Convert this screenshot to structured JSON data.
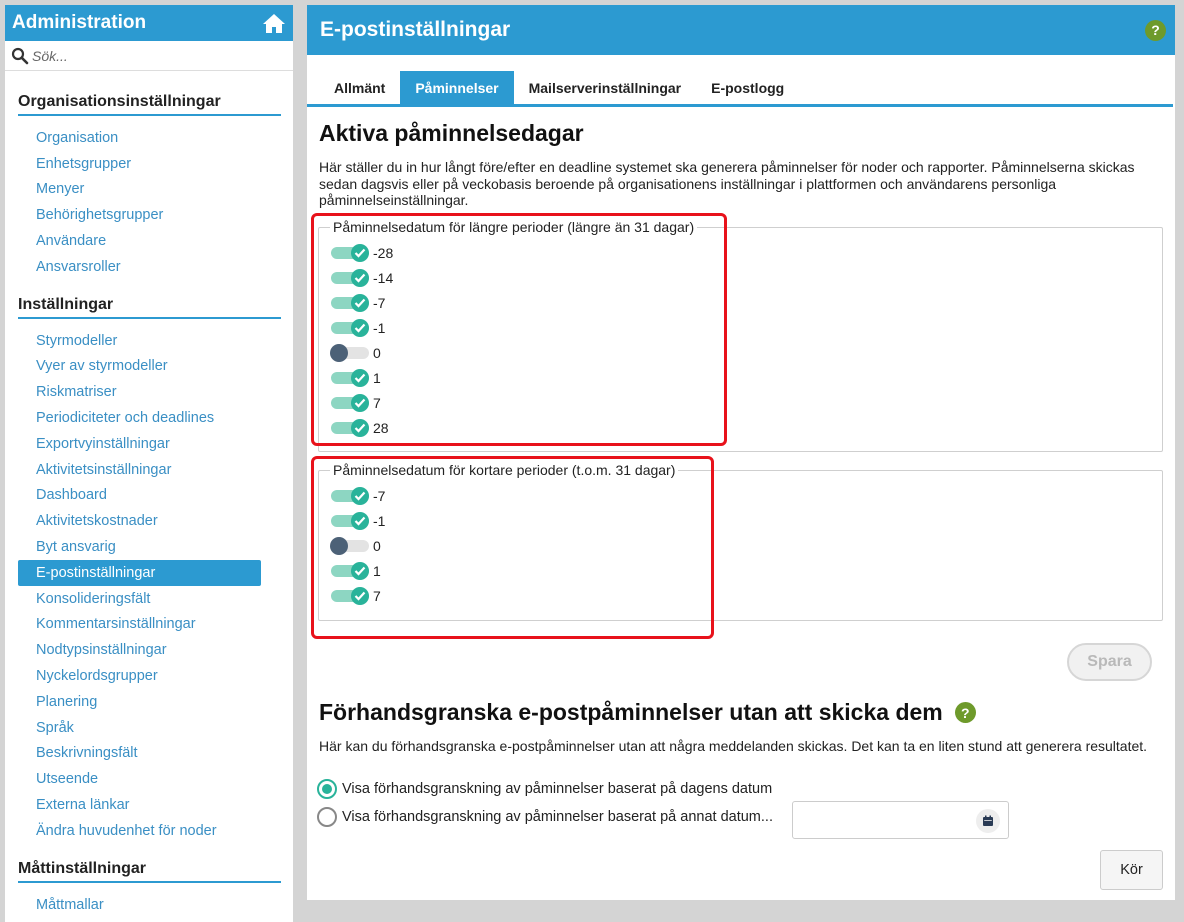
{
  "sidebar": {
    "title": "Administration",
    "search_placeholder": "Sök...",
    "sections": [
      {
        "title": "Organisationsinställningar",
        "items": [
          "Organisation",
          "Enhetsgrupper",
          "Menyer",
          "Behörighetsgrupper",
          "Användare",
          "Ansvarsroller"
        ]
      },
      {
        "title": "Inställningar",
        "items": [
          "Styrmodeller",
          "Vyer av styrmodeller",
          "Riskmatriser",
          "Periodiciteter och deadlines",
          "Exportvyinställningar",
          "Aktivitetsinställningar",
          "Dashboard",
          "Aktivitetskostnader",
          "Byt ansvarig",
          "E-postinställningar",
          "Konsolideringsfält",
          "Kommentarsinställningar",
          "Nodtypsinställningar",
          "Nyckelordsgrupper",
          "Planering",
          "Språk",
          "Beskrivningsfält",
          "Utseende",
          "Externa länkar",
          "Ändra huvudenhet för noder"
        ]
      },
      {
        "title": "Måttinställningar",
        "items": [
          "Måttmallar"
        ]
      }
    ],
    "active_item": "E-postinställningar"
  },
  "main": {
    "title": "E-postinställningar",
    "tabs": [
      {
        "label": "Allmänt",
        "active": false
      },
      {
        "label": "Påminnelser",
        "active": true
      },
      {
        "label": "Mailserverinställningar",
        "active": false
      },
      {
        "label": "E-postlogg",
        "active": false
      }
    ],
    "heading": "Aktiva påminnelsedagar",
    "description": "Här ställer du in hur långt före/efter en deadline systemet ska generera påminnelser för noder och rapporter. Påminnelserna skickas sedan dagsvis eller på veckobasis beroende på organisationens inställningar i plattformen och användarens personliga påminnelseinställningar.",
    "long_group": {
      "legend": "Påminnelsedatum för längre perioder (längre än 31 dagar)",
      "toggles": [
        {
          "label": "-28",
          "on": true
        },
        {
          "label": "-14",
          "on": true
        },
        {
          "label": "-7",
          "on": true
        },
        {
          "label": "-1",
          "on": true
        },
        {
          "label": "0",
          "on": false
        },
        {
          "label": "1",
          "on": true
        },
        {
          "label": "7",
          "on": true
        },
        {
          "label": "28",
          "on": true
        }
      ]
    },
    "short_group": {
      "legend": "Påminnelsedatum för kortare perioder (t.o.m. 31 dagar)",
      "toggles": [
        {
          "label": "-7",
          "on": true
        },
        {
          "label": "-1",
          "on": true
        },
        {
          "label": "0",
          "on": false
        },
        {
          "label": "1",
          "on": true
        },
        {
          "label": "7",
          "on": true
        }
      ]
    },
    "save_label": "Spara",
    "preview": {
      "heading": "Förhandsgranska e-postpåminnelser utan att skicka dem",
      "description": "Här kan du förhandsgranska e-postpåminnelser utan att några meddelanden skickas. Det kan ta en liten stund att generera resultatet.",
      "option_today": "Visa förhandsgranskning av påminnelser baserat på dagens datum",
      "option_other": "Visa förhandsgranskning av påminnelser baserat på annat datum...",
      "selected": "today",
      "date_value": "",
      "run_label": "Kör"
    }
  },
  "colors": {
    "accent": "#2c9ad1",
    "toggle_on": "#29b39a",
    "toggle_off": "#4c6177",
    "help": "#6e9a2b",
    "highlight": "#e8121b"
  }
}
